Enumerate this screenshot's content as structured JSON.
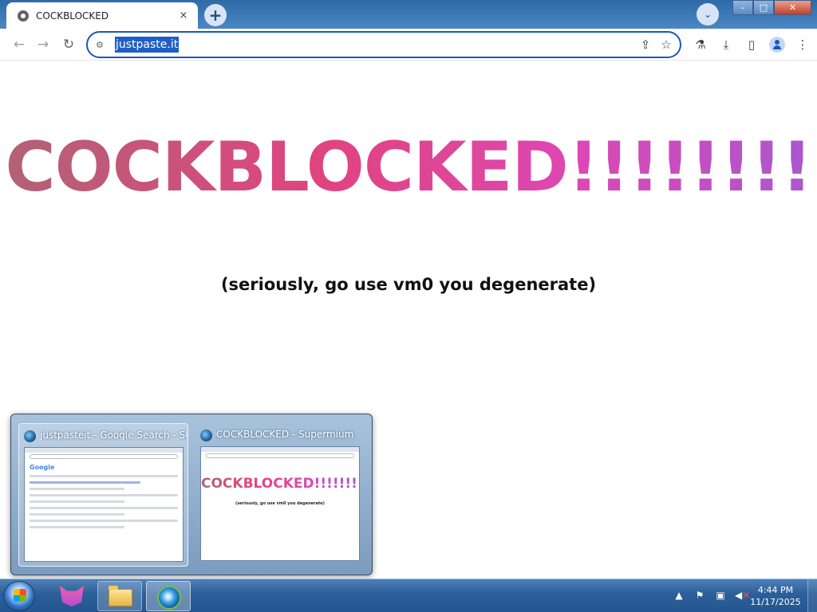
{
  "browser": {
    "tab": {
      "title": "COCKBLOCKED",
      "close_icon": "×"
    },
    "new_tab_icon": "+",
    "tab_search_icon": "⌄",
    "window_controls": {
      "minimize": "–",
      "maximize": "□",
      "close": "✕"
    },
    "nav": {
      "back": "←",
      "forward": "→",
      "reload": "↻"
    },
    "omnibox": {
      "site_info_icon": "⚙",
      "url": "justpaste.it"
    },
    "omnibox_icons": {
      "share": "⇪",
      "bookmark": "☆"
    },
    "toolbar_icons": {
      "labs": "⚗",
      "download": "⤓",
      "side_panel": "▯",
      "menu": "⋮"
    }
  },
  "page": {
    "headline": "COCKBLOCKED!!!!!!!!",
    "subline": "(seriously, go use vm0 you degenerate)"
  },
  "taskbar_preview": {
    "thumbnails": [
      {
        "title": "justpasteit - Google Search - Su...",
        "mini_logo": "Google"
      },
      {
        "title": "COCKBLOCKED - Supermium",
        "mini_headline": "COCKBLOCKED!!!!!!!!",
        "mini_sub": "(seriously, go use vm0 you degenerate)"
      }
    ]
  },
  "taskbar": {
    "tray_icons": {
      "show_hidden": "▲",
      "action_center": "⚑",
      "network": "▣",
      "volume": "◀"
    },
    "tray_x": "✕",
    "clock": {
      "time": "4:44 PM",
      "date": "11/17/2025"
    }
  },
  "colors": {
    "headline_gradient": [
      "#b26276",
      "#e0447f",
      "#de47b4",
      "#a958d0"
    ],
    "taskbar": "#2c5f99",
    "url_highlight": "#1f5ec8"
  }
}
